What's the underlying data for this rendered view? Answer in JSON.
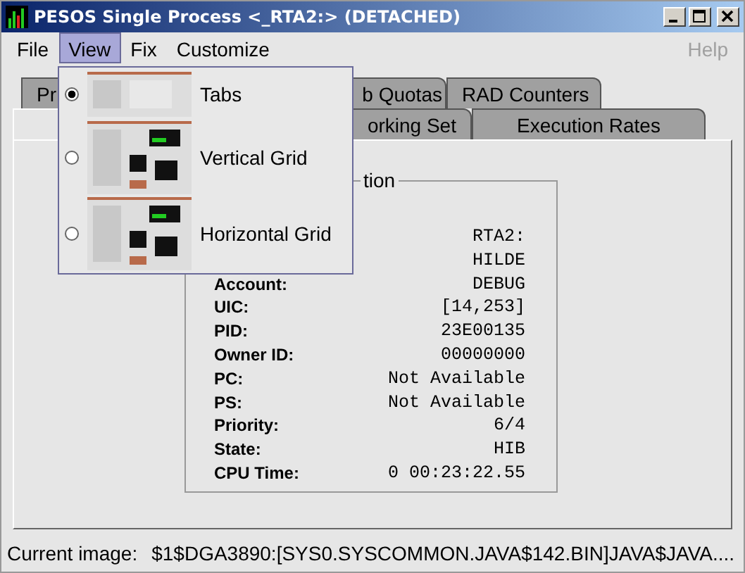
{
  "window": {
    "title": "PESOS Single Process <_RTA2:> (DETACHED)"
  },
  "menu_bar": [
    {
      "label": "File",
      "selected": false,
      "disabled": false
    },
    {
      "label": "View",
      "selected": true,
      "disabled": false
    },
    {
      "label": "Fix",
      "selected": false,
      "disabled": false
    },
    {
      "label": "Customize",
      "selected": false,
      "disabled": false
    },
    {
      "label": "Help",
      "selected": false,
      "disabled": true
    }
  ],
  "view_menu": [
    {
      "label": "Tabs",
      "selected": true
    },
    {
      "label": "Vertical Grid",
      "selected": false
    },
    {
      "label": "Horizontal Grid",
      "selected": false
    }
  ],
  "tabs_back_row": [
    {
      "label": "Pr",
      "selected": false
    },
    {
      "label": "b Quotas",
      "selected": false
    },
    {
      "label": "RAD Counters",
      "selected": false
    }
  ],
  "tabs_front_row": [
    {
      "selected": true
    },
    {
      "label": "orking Set",
      "selected": false
    },
    {
      "label": "Execution Rates",
      "selected": false
    }
  ],
  "group": {
    "title": "tion",
    "fields": [
      {
        "value": "RTA2:"
      },
      {
        "value": "HILDE"
      },
      {
        "label": "Account:",
        "value": "DEBUG"
      },
      {
        "label": "UIC:",
        "value": "[14,253]"
      },
      {
        "label": "PID:",
        "value": "23E00135"
      },
      {
        "label": "Owner ID:",
        "value": "00000000"
      },
      {
        "label": "PC:",
        "value": "Not Available"
      },
      {
        "label": "PS:",
        "value": "Not Available"
      },
      {
        "label": "Priority:",
        "value": "6/4"
      },
      {
        "label": "State:",
        "value": "HIB"
      },
      {
        "label": "CPU Time:",
        "value": "0 00:23:22.55"
      }
    ]
  },
  "status_bar": {
    "label": "Current image:",
    "value": "$1$DGA3890:[SYS0.SYSCOMMON.JAVA$142.BIN]JAVA$JAVA...."
  }
}
